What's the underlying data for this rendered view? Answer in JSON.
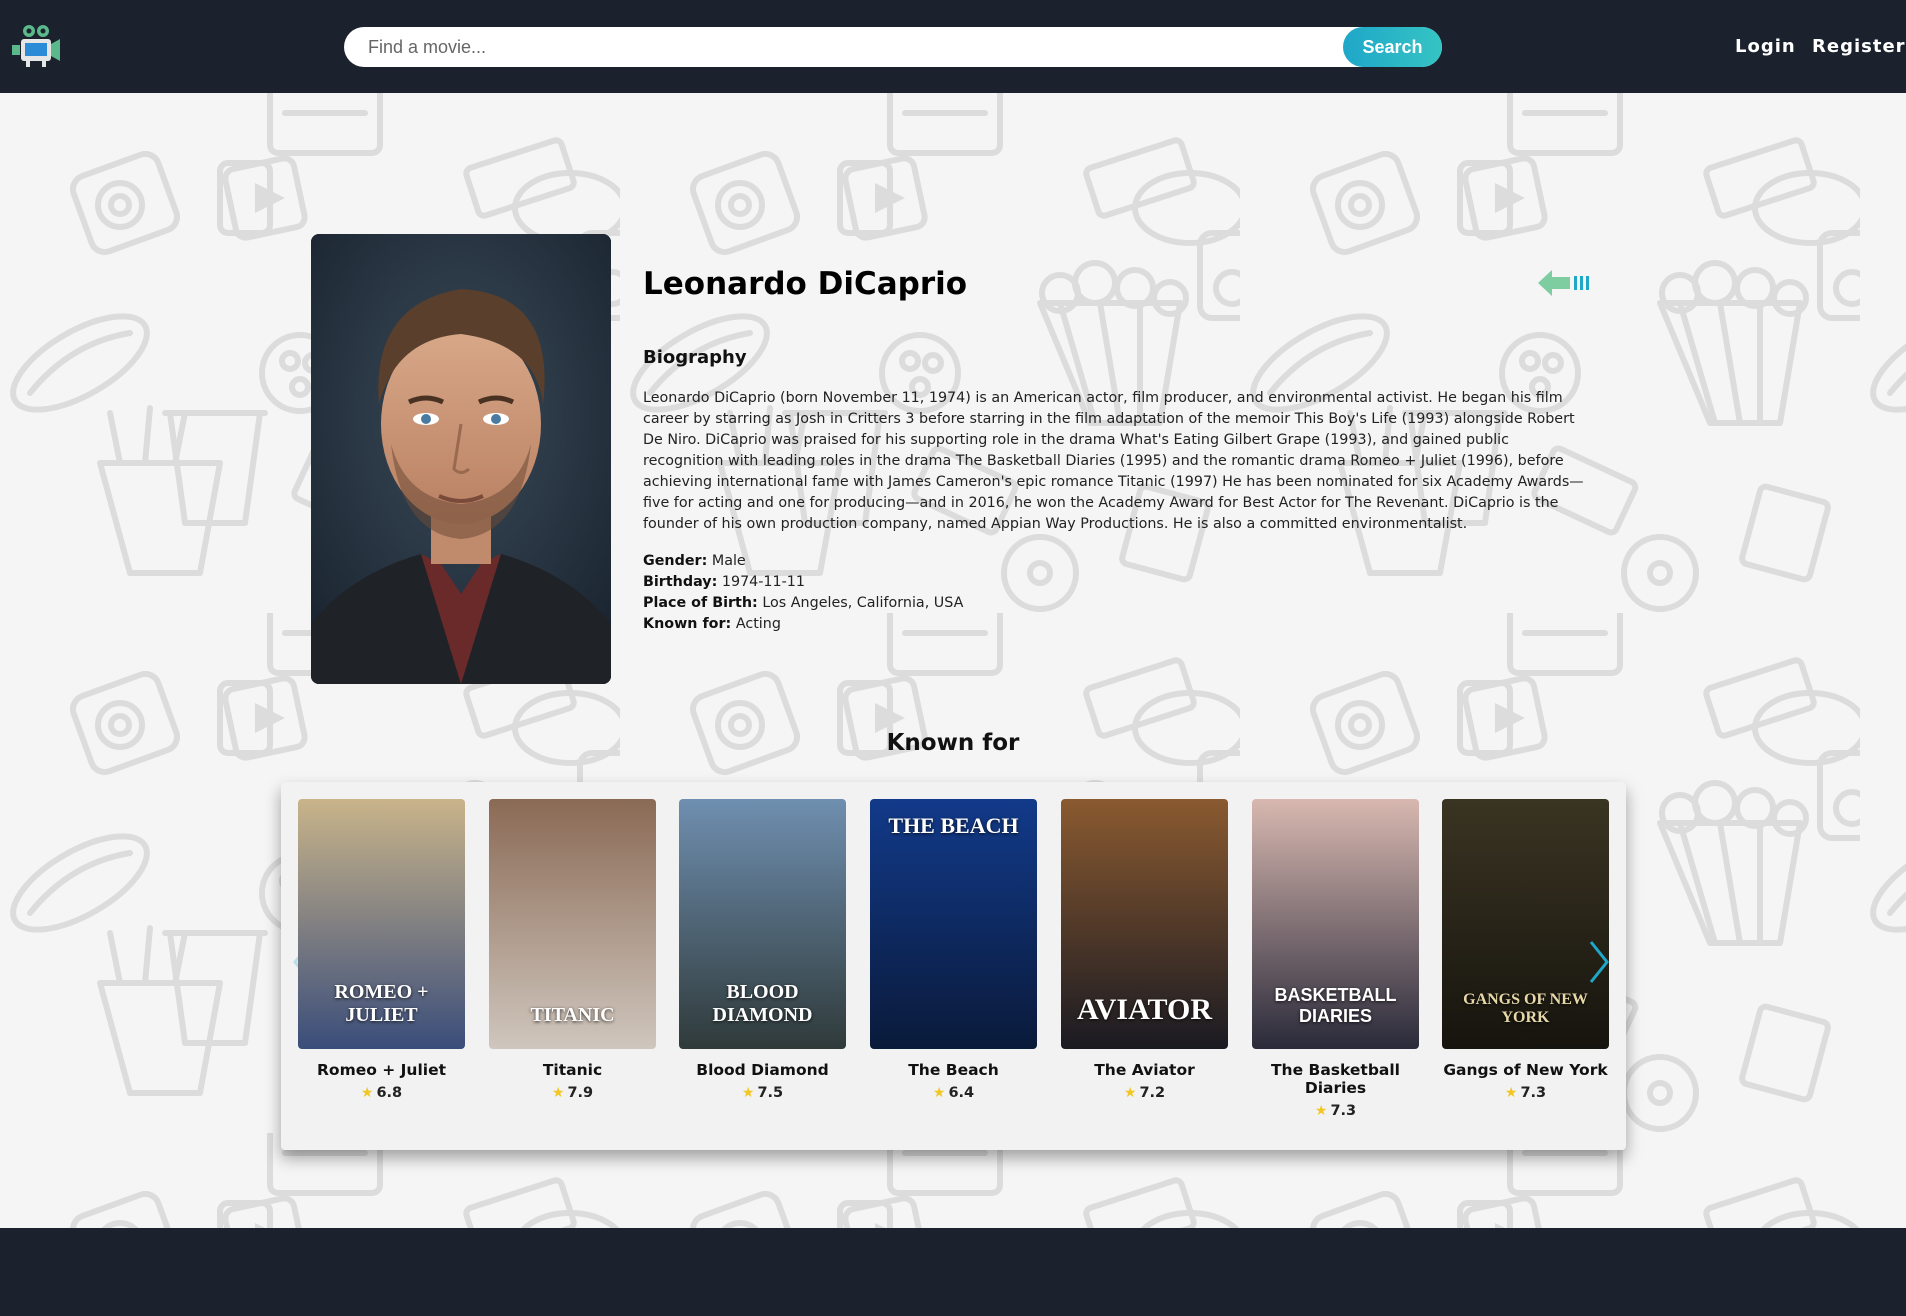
{
  "header": {
    "logo_icon": "movie-camera-icon",
    "search_placeholder": "Find a movie...",
    "search_label": "Search",
    "login_label": "Login",
    "register_label": "Register"
  },
  "person": {
    "name": "Leonardo DiCaprio",
    "back_icon": "back-arrow-icon",
    "biography_heading": "Biography",
    "biography": "Leonardo DiCaprio (born November 11, 1974) is an American actor, film producer, and environmental activist. He began his film career by starring as Josh in Critters 3 before starring in the film adaptation of the memoir This Boy's Life (1993) alongside Robert De Niro. DiCaprio was praised for his supporting role in the drama What's Eating Gilbert Grape (1993), and gained public recognition with leading roles in the drama The Basketball Diaries (1995) and the romantic drama Romeo + Juliet (1996), before achieving international fame with James Cameron's epic romance Titanic (1997) He has been nominated for six Academy Awards—five for acting and one for producing—and in 2016, he won the Academy Award for Best Actor for The Revenant. DiCaprio is the founder of his own production company, named Appian Way Productions. He is also a committed environmentalist.",
    "facts": [
      {
        "label": "Gender:",
        "value": "Male"
      },
      {
        "label": "Birthday:",
        "value": "1974-11-11"
      },
      {
        "label": "Place of Birth:",
        "value": "Los Angeles, California, USA"
      },
      {
        "label": "Known for:",
        "value": "Acting"
      }
    ]
  },
  "known_for": {
    "heading": "Known for",
    "movies": [
      {
        "title": "Romeo + Juliet",
        "rating": "6.8",
        "poster_text": "ROMEO + JULIET",
        "color_top": "#c9b48a",
        "color_bottom": "#3a4d7a"
      },
      {
        "title": "Titanic",
        "rating": "7.9",
        "poster_text": "TITANIC",
        "color_top": "#8a6a55",
        "color_bottom": "#cfc6bd"
      },
      {
        "title": "Blood Diamond",
        "rating": "7.5",
        "poster_text": "BLOOD DIAMOND",
        "color_top": "#6f8fb0",
        "color_bottom": "#2f3a3a"
      },
      {
        "title": "The Beach",
        "rating": "6.4",
        "poster_text": "THE BEACH",
        "color_top": "#123a8a",
        "color_bottom": "#0a1a3a"
      },
      {
        "title": "The Aviator",
        "rating": "7.2",
        "poster_text": "AVIATOR",
        "color_top": "#8a5a30",
        "color_bottom": "#1a1a22"
      },
      {
        "title": "The Basketball Diaries",
        "rating": "7.3",
        "poster_text": "BASKETBALL DIARIES",
        "color_top": "#d8b8b0",
        "color_bottom": "#2a2a3a"
      },
      {
        "title": "Gangs of New York",
        "rating": "7.3",
        "poster_text": "GANGS OF NEW YORK",
        "color_top": "#3a3422",
        "color_bottom": "#16140e"
      }
    ]
  },
  "colors": {
    "header_bg": "#1b222e",
    "accent": "#1fa7c9",
    "star": "#f3c623"
  }
}
